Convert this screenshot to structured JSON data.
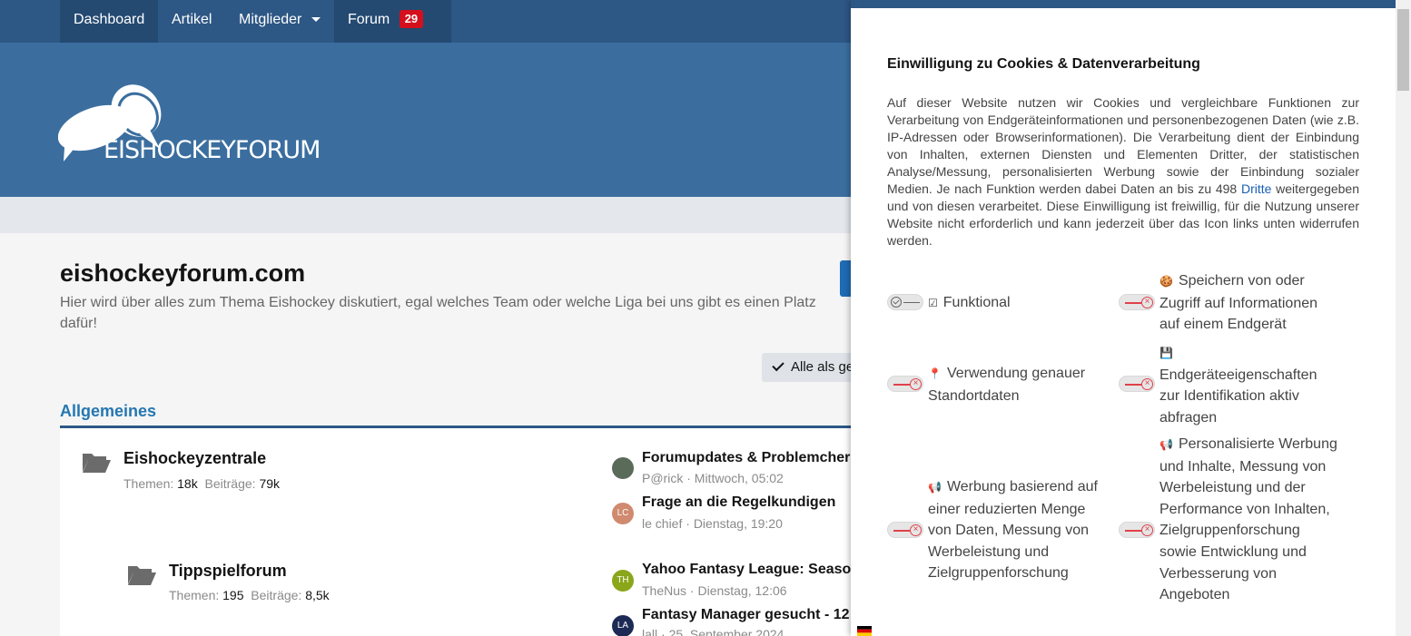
{
  "nav": {
    "items": [
      {
        "label": "Dashboard"
      },
      {
        "label": "Artikel"
      },
      {
        "label": "Mitglieder"
      },
      {
        "label": "Forum",
        "badge": "29"
      }
    ]
  },
  "header": {
    "logo_text": "EISHOCKEYFORUM"
  },
  "page": {
    "title": "eishockeyforum.com",
    "description": "Hier wird über alles zum Thema Eishockey diskutiert, egal welches Team oder welche Liga bei uns gibt es einen Platz dafür!",
    "mark_read_label": "Alle als ge"
  },
  "section": {
    "title": "Allgemeines",
    "forums": [
      {
        "name": "Eishockeyzentrale",
        "themen_label": "Themen:",
        "themen": "18k",
        "beitraege_label": "Beiträge:",
        "beitraege": "79k",
        "latest": [
          {
            "title": "Forumupdates & Problemcher",
            "author": "P@rick",
            "date": "Mittwoch, 05:02",
            "avatar": "",
            "avatar_color": "#5a6b5a"
          },
          {
            "title": "Frage an die Regelkundigen",
            "author": "le chief",
            "date": "Dienstag, 19:20",
            "avatar": "LC",
            "avatar_color": "#d08a6f"
          }
        ]
      },
      {
        "name": "Tippspielforum",
        "themen_label": "Themen:",
        "themen": "195",
        "beitraege_label": "Beiträge:",
        "beitraege": "8,5k",
        "latest": [
          {
            "title": "Yahoo Fantasy League: Seaso",
            "author": "TheNus",
            "date": "Dienstag, 12:06",
            "avatar": "TH",
            "avatar_color": "#8aa61a"
          },
          {
            "title": "Fantasy Manager gesucht - 12",
            "author": "lall",
            "date": "25. September 2024",
            "avatar": "LA",
            "avatar_color": "#1c2a55"
          }
        ]
      }
    ]
  },
  "consent": {
    "title": "Einwilligung zu Cookies & Datenverarbeitung",
    "text_before_link": "Auf dieser Website nutzen wir Cookies und vergleichbare Funktionen zur Verarbeitung von Endgeräteinformationen und personenbezogenen Daten (wie z.B. IP-Adressen oder Browserinformationen). Die Verarbeitung dient der Einbindung von Inhalten, externen Diensten und Elementen Dritter, der statistischen Analyse/Messung, personalisierten Werbung sowie der Einbindung sozialer Medien. Je nach Funktion werden dabei Daten an bis zu 498 ",
    "link_text": "Dritte",
    "text_after_link": " weitergegeben und von diesen verarbeitet. Diese Einwilligung ist freiwillig, für die Nutzung unserer Website nicht erforderlich und kann jederzeit über das Icon links unten widerrufen werden.",
    "options": [
      {
        "label": "Funktional",
        "icon": "☑",
        "enabled": true
      },
      {
        "label": "Speichern von oder Zugriff auf Informationen auf einem Endgerät",
        "icon": "🍪",
        "enabled": false
      },
      {
        "label": "Verwendung genauer Standortdaten",
        "icon": "📍",
        "enabled": false
      },
      {
        "label": "Endgeräteeigenschaften zur Identifikation aktiv abfragen",
        "icon": "💾",
        "enabled": false
      },
      {
        "label": "Werbung basierend auf einer reduzierten Menge von Daten, Messung von Werbeleistung und Zielgruppenforschung",
        "icon": "📢",
        "enabled": false
      },
      {
        "label": "Personalisierte Werbung und Inhalte, Messung von Werbeleistung und der Performance von Inhalten, Zielgruppenforschung sowie Entwicklung und Verbesserung von Angeboten",
        "icon": "📢",
        "enabled": false
      }
    ]
  },
  "colors": {
    "nav_bg": "#2d5785",
    "banner_bg": "#3b6e9f",
    "accent_blue": "#2577b1",
    "badge_red": "#d4101c",
    "toggle_off": "#e0414a"
  }
}
